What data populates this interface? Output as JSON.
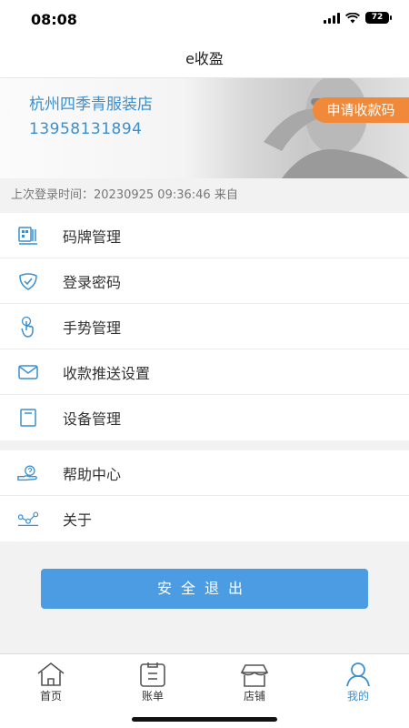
{
  "status_bar": {
    "time": "08:08",
    "battery": "72"
  },
  "nav": {
    "title": "e收盈"
  },
  "banner": {
    "shop_name": "杭州四季青服装店",
    "phone": "13958131894",
    "apply_button": "申请收款码"
  },
  "login_info": "上次登录时间：20230925 09:36:46  来自",
  "menu": [
    {
      "label": "码牌管理",
      "icon": "qr-plate-icon"
    },
    {
      "label": "登录密码",
      "icon": "shield-icon"
    },
    {
      "label": "手势管理",
      "icon": "gesture-hand-icon"
    },
    {
      "label": "收款推送设置",
      "icon": "envelope-icon"
    },
    {
      "label": "设备管理",
      "icon": "device-icon"
    }
  ],
  "menu2": [
    {
      "label": "帮助中心",
      "icon": "help-hand-icon"
    },
    {
      "label": "关于",
      "icon": "share-nodes-icon"
    }
  ],
  "logout_button": "安全退出",
  "tabs": [
    {
      "label": "首页",
      "icon": "home-icon"
    },
    {
      "label": "账单",
      "icon": "bill-icon"
    },
    {
      "label": "店铺",
      "icon": "shop-icon"
    },
    {
      "label": "我的",
      "icon": "user-icon",
      "active": true
    }
  ],
  "colors": {
    "accent": "#3a8fd0",
    "orange": "#f08a3a",
    "button": "#4b9ce3"
  }
}
